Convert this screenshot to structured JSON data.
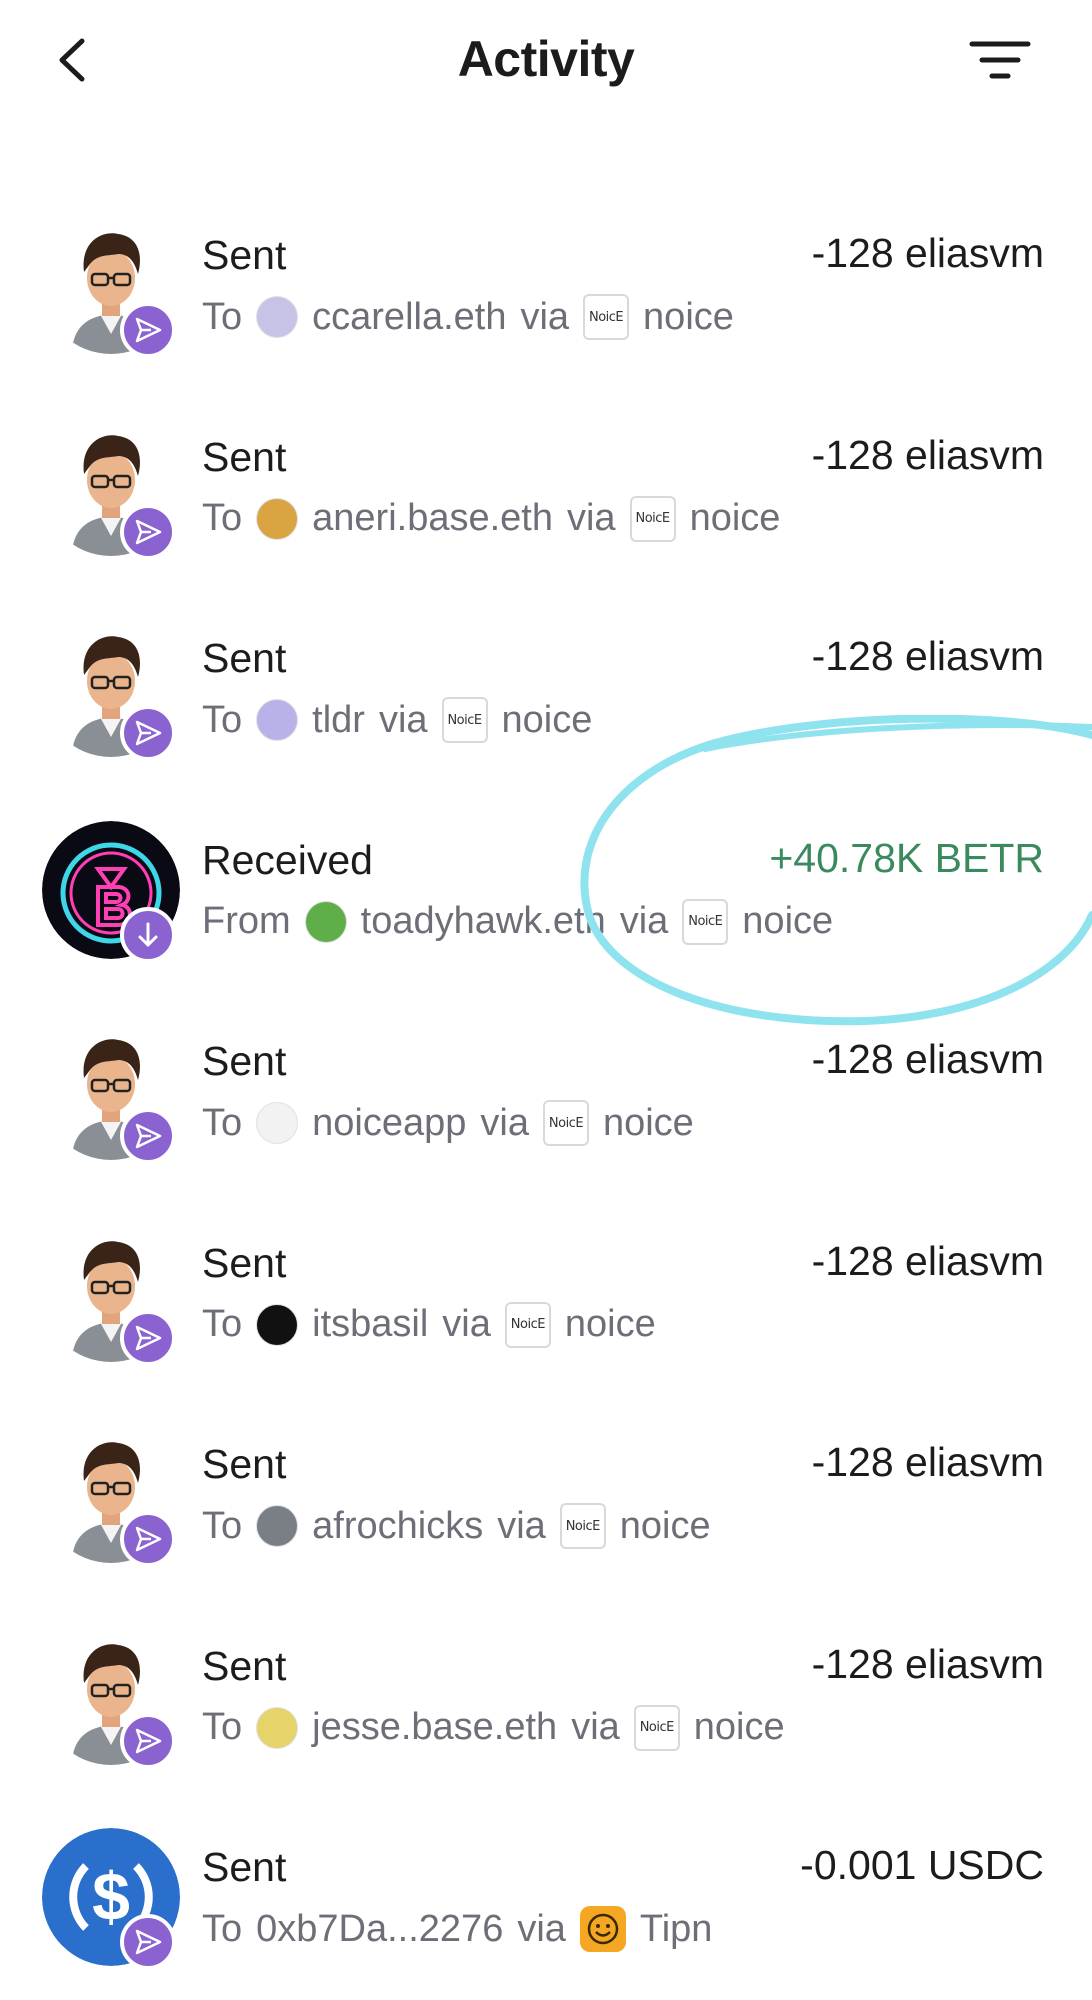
{
  "header": {
    "title": "Activity"
  },
  "colors": {
    "badge": "#8b63d0",
    "positive": "#3b8a5e",
    "secondary_text": "#6e6e78",
    "highlight": "#8fe3ef",
    "usdc_blue": "#2a6fcc"
  },
  "transactions": [
    {
      "type": "Sent",
      "amount": "-128 eliasvm",
      "preposition": "To",
      "counterparty": "ccarella.eth",
      "via": "via",
      "app": "noice",
      "app_icon_text": "NoicE",
      "avatar_icon": "user-portrait",
      "badge_icon": "send-icon",
      "counterparty_avatar_color": "#c7c3e6"
    },
    {
      "type": "Sent",
      "amount": "-128 eliasvm",
      "preposition": "To",
      "counterparty": "aneri.base.eth",
      "via": "via",
      "app": "noice",
      "app_icon_text": "NoicE",
      "avatar_icon": "user-portrait",
      "badge_icon": "send-icon",
      "counterparty_avatar_color": "#d9a441"
    },
    {
      "type": "Sent",
      "amount": "-128 eliasvm",
      "preposition": "To",
      "counterparty": "tldr",
      "via": "via",
      "app": "noice",
      "app_icon_text": "NoicE",
      "avatar_icon": "user-portrait",
      "badge_icon": "send-icon",
      "counterparty_avatar_color": "#b9b2e8"
    },
    {
      "type": "Received",
      "amount": "+40.78K BETR",
      "preposition": "From",
      "counterparty": "toadyhawk.eth",
      "via": "via",
      "app": "noice",
      "app_icon_text": "NoicE",
      "avatar_icon": "betr-token-logo",
      "badge_icon": "receive-icon",
      "counterparty_avatar_color": "#5fae4a"
    },
    {
      "type": "Sent",
      "amount": "-128 eliasvm",
      "preposition": "To",
      "counterparty": "noiceapp",
      "via": "via",
      "app": "noice",
      "app_icon_text": "NoicE",
      "avatar_icon": "user-portrait",
      "badge_icon": "send-icon",
      "counterparty_avatar_color": "#f2f2f2"
    },
    {
      "type": "Sent",
      "amount": "-128 eliasvm",
      "preposition": "To",
      "counterparty": "itsbasil",
      "via": "via",
      "app": "noice",
      "app_icon_text": "NoicE",
      "avatar_icon": "user-portrait",
      "badge_icon": "send-icon",
      "counterparty_avatar_color": "#111111"
    },
    {
      "type": "Sent",
      "amount": "-128 eliasvm",
      "preposition": "To",
      "counterparty": "afrochicks",
      "via": "via",
      "app": "noice",
      "app_icon_text": "NoicE",
      "avatar_icon": "user-portrait",
      "badge_icon": "send-icon",
      "counterparty_avatar_color": "#7a7f86"
    },
    {
      "type": "Sent",
      "amount": "-128 eliasvm",
      "preposition": "To",
      "counterparty": "jesse.base.eth",
      "via": "via",
      "app": "noice",
      "app_icon_text": "NoicE",
      "avatar_icon": "user-portrait",
      "badge_icon": "send-icon",
      "counterparty_avatar_color": "#e6d36a"
    },
    {
      "type": "Sent",
      "amount": "-0.001 USDC",
      "preposition": "To",
      "counterparty": "0xb7Da...2276",
      "via": "via",
      "app": "Tipn",
      "app_icon_text": "",
      "avatar_icon": "usdc-logo",
      "badge_icon": "send-icon",
      "counterparty_avatar_color": ""
    }
  ]
}
